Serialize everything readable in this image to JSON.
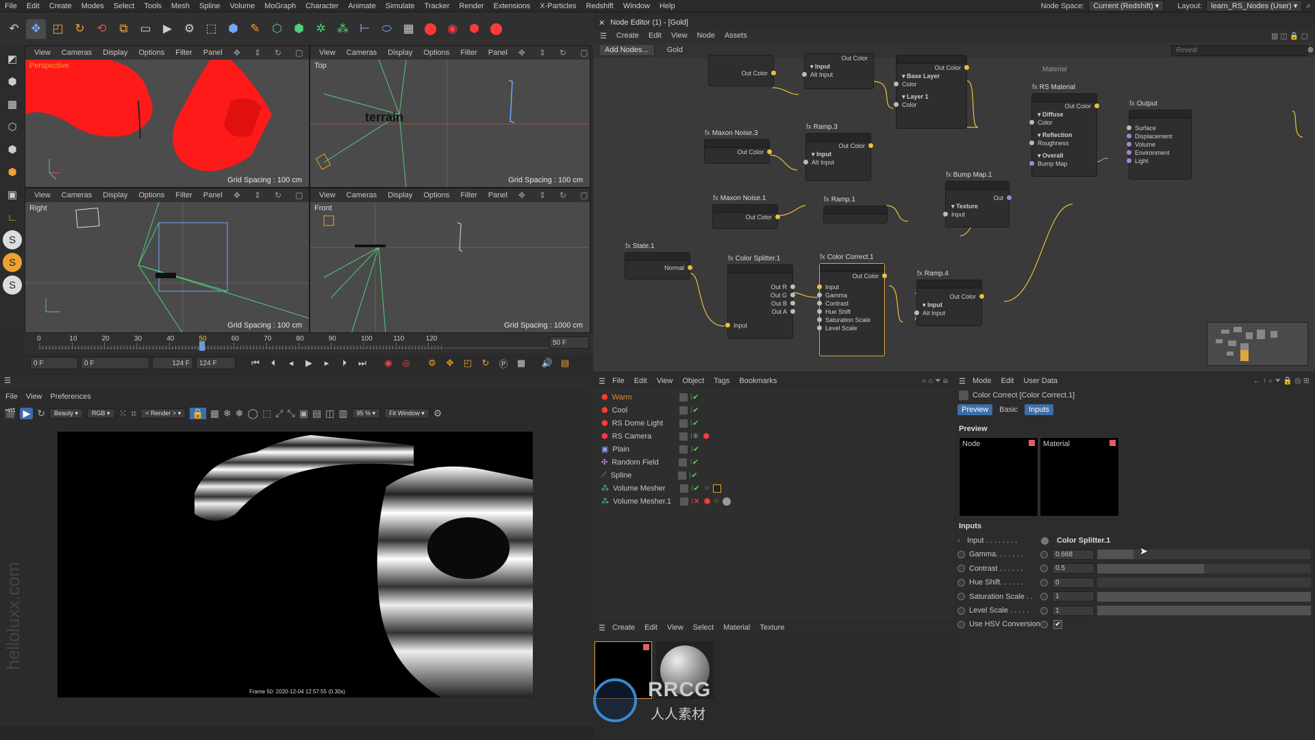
{
  "menubar": {
    "items": [
      "File",
      "Edit",
      "Create",
      "Modes",
      "Select",
      "Tools",
      "Mesh",
      "Spline",
      "Volume",
      "MoGraph",
      "Character",
      "Animate",
      "Simulate",
      "Tracker",
      "Render",
      "Extensions",
      "X-Particles",
      "Redshift",
      "Window",
      "Help"
    ],
    "node_space_label": "Node Space:",
    "node_space_value": "Current (Redshift)",
    "layout_label": "Layout:",
    "layout_value": "learn_RS_Nodes (User)"
  },
  "viewport_menu": [
    "View",
    "Cameras",
    "Display",
    "Options",
    "Filter",
    "Panel"
  ],
  "viewports": {
    "perspective": {
      "label": "Perspective",
      "grid": "Grid Spacing : 100 cm"
    },
    "top": {
      "label": "Top",
      "grid": "Grid Spacing : 100 cm",
      "object_text": "terrain"
    },
    "right": {
      "label": "Right",
      "grid": "Grid Spacing : 100 cm"
    },
    "front": {
      "label": "Front",
      "grid": "Grid Spacing : 1000 cm"
    }
  },
  "timeline": {
    "ticks": [
      "0",
      "10",
      "20",
      "30",
      "40",
      "50",
      "60",
      "70",
      "80",
      "90",
      "100",
      "110",
      "120"
    ],
    "current": "50",
    "current_frame_field": "50 F",
    "start": "0 F",
    "min": "0 F",
    "max": "124 F",
    "end": "124 F"
  },
  "render_view": {
    "menu": [
      "File",
      "View",
      "Preferences"
    ],
    "beauty": "Beauty",
    "rgb": "RGB",
    "render_dd": "< Render >",
    "zoom": "95 %",
    "fit": "Fit Window",
    "caption": "Frame 50:  2020-12-04  12:57:55  (0.30s)"
  },
  "node_editor": {
    "title": "Node Editor (1) - [Gold]",
    "menu": [
      "Create",
      "Edit",
      "View",
      "Node",
      "Assets"
    ],
    "add_nodes": "Add Nodes...",
    "material_name": "Gold",
    "reveal_placeholder": "Reveal",
    "nodes": {
      "top1_out": "Out Color",
      "ramp2_input": "Input",
      "ramp2_alt": "Alt Input",
      "ramp2_out": "Out Color",
      "layer_out": "Out Color",
      "layer_base": "Base Layer",
      "layer_base_color": "Color",
      "layer_1": "Layer 1",
      "layer_1_color": "Color",
      "noise3_title": "Maxon Noise.3",
      "noise3_out": "Out Color",
      "ramp3_title": "Ramp.3",
      "ramp3_out": "Out Color",
      "ramp3_input": "Input",
      "ramp3_alt": "Alt Input",
      "rsmat_group": "Material",
      "rsmat_title": "RS Material",
      "rsmat_out": "Out Color",
      "rsmat_diffuse": "Diffuse",
      "rsmat_color": "Color",
      "rsmat_reflection": "Reflection",
      "rsmat_roughness": "Roughness",
      "rsmat_overall": "Overall",
      "rsmat_bump": "Bump Map",
      "output_title": "Output",
      "output_ports": [
        "Surface",
        "Displacement",
        "Volume",
        "Environment",
        "Light"
      ],
      "bump_title": "Bump Map.1",
      "bump_out": "Out",
      "bump_texture": "Texture",
      "bump_input": "Input",
      "noise1_title": "Maxon Noise.1",
      "noise1_out": "Out Color",
      "ramp1_title": "Ramp.1",
      "state_title": "State.1",
      "state_out": "Normal",
      "splitter_title": "Color Splitter.1",
      "splitter_outs": [
        "Out R",
        "Out G",
        "Out B",
        "Out A"
      ],
      "splitter_input": "Input",
      "cc_title": "Color Correct.1",
      "cc_out": "Out Color",
      "cc_inputs": [
        "Input",
        "Gamma",
        "Contrast",
        "Hue Shift",
        "Saturation Scale",
        "Level Scale"
      ],
      "ramp4_title": "Ramp.4",
      "ramp4_out": "Out Color",
      "ramp4_input": "Input",
      "ramp4_alt": "Alt Input"
    }
  },
  "object_manager": {
    "menu": [
      "File",
      "Edit",
      "View",
      "Object",
      "Tags",
      "Bookmarks"
    ],
    "objects": [
      {
        "name": "Warm",
        "color": "#e08a30"
      },
      {
        "name": "Cool",
        "color": "#c8c8c8"
      },
      {
        "name": "RS Dome Light",
        "color": "#c8c8c8"
      },
      {
        "name": "RS Camera",
        "color": "#c8c8c8"
      },
      {
        "name": "Plain",
        "color": "#c8c8c8"
      },
      {
        "name": "Random Field",
        "color": "#c8c8c8"
      },
      {
        "name": "Spline",
        "color": "#c8c8c8"
      },
      {
        "name": "Volume Mesher",
        "color": "#c8c8c8"
      },
      {
        "name": "Volume Mesher.1",
        "color": "#c8c8c8"
      }
    ]
  },
  "material_manager": {
    "menu": [
      "Create",
      "Edit",
      "View",
      "Select",
      "Material",
      "Texture"
    ]
  },
  "attribute_manager": {
    "menu": [
      "Mode",
      "Edit",
      "User Data"
    ],
    "title": "Color Correct [Color Correct.1]",
    "tabs": [
      "Preview",
      "Basic",
      "Inputs"
    ],
    "preview_heading": "Preview",
    "preview_node": "Node",
    "preview_material": "Material",
    "inputs_heading": "Inputs",
    "input_label": "Input . . . . . . . .",
    "input_value": "Color Splitter.1",
    "rows": [
      {
        "label": "Gamma. . . . . . .",
        "value": "0.668",
        "fill": 0.17
      },
      {
        "label": "Contrast . . . . . .",
        "value": "0.5",
        "fill": 0.5
      },
      {
        "label": "Hue Shift. . . . . .",
        "value": "0",
        "fill": 0
      },
      {
        "label": "Saturation Scale . .",
        "value": "1",
        "fill": 1
      },
      {
        "label": "Level Scale . . . . .",
        "value": "1",
        "fill": 1
      }
    ],
    "hsv_label": "Use HSV Conversion",
    "hsv_checked": true
  },
  "watermark": {
    "text": "RRCG",
    "subtext": "人人素材"
  },
  "colors": {
    "accent": "#3e6ea8",
    "node_wire": "#e8c23a",
    "selected_node": "#e0a640",
    "red_object": "#ff1a1a"
  }
}
